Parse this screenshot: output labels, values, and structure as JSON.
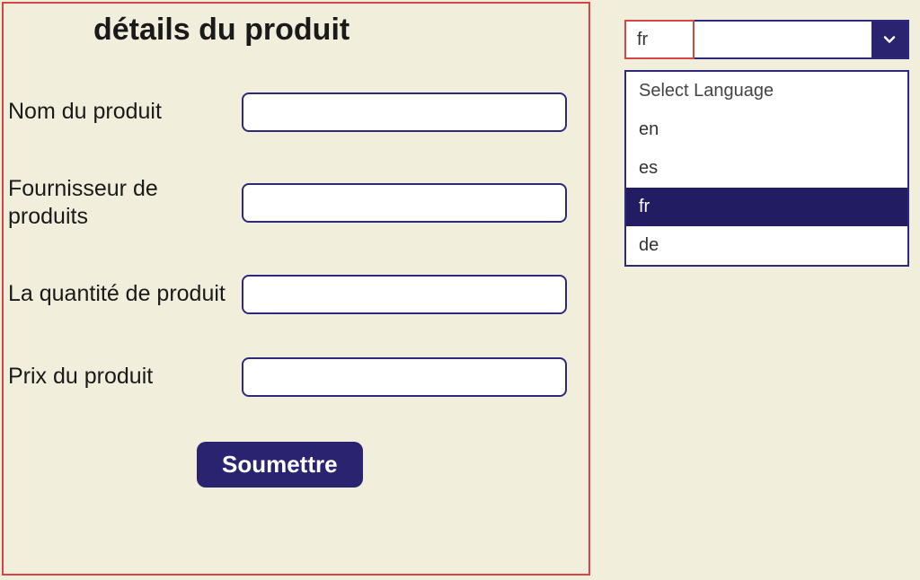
{
  "form": {
    "title": "détails du produit",
    "fields": {
      "name_label": "Nom du produit",
      "name_value": "",
      "supplier_label": "Fournisseur de produits",
      "supplier_value": "",
      "quantity_label": "La quantité de produit",
      "quantity_value": "",
      "price_label": "Prix du produit",
      "price_value": ""
    },
    "submit_label": "Soumettre"
  },
  "language": {
    "current": "fr",
    "placeholder": "Select Language",
    "options": [
      "en",
      "es",
      "fr",
      "de"
    ],
    "selected": "fr"
  },
  "colors": {
    "accent": "#2a2370",
    "border": "#2e2a7b",
    "highlight": "#d94444",
    "bg": "#f2eedc"
  }
}
